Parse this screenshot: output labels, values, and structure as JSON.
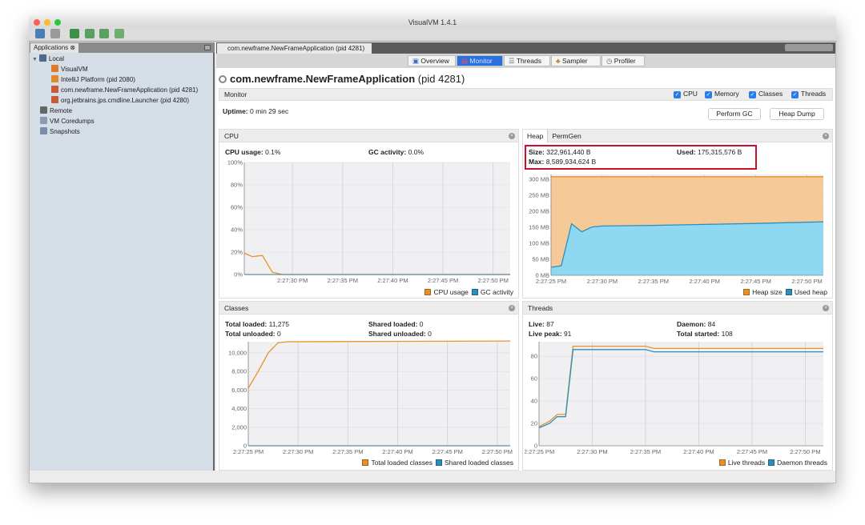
{
  "window": {
    "title": "VisualVM 1.4.1"
  },
  "toolbar": {
    "icons": [
      "open-icon",
      "save-icon",
      "add-jmx-icon",
      "add-coredump-icon",
      "add-remote-icon",
      "snapshot-icon"
    ]
  },
  "sidebar": {
    "tab": "Applications",
    "items": [
      {
        "label": "Local",
        "icon": "computer-icon"
      },
      {
        "label": "VisualVM",
        "icon": "visualvm-icon"
      },
      {
        "label": "IntelliJ Platform (pid 2080)",
        "icon": "intellij-icon"
      },
      {
        "label": "com.newframe.NewFrameApplication (pid 4281)",
        "icon": "java-icon"
      },
      {
        "label": "org.jetbrains.jps.cmdline.Launcher (pid 4280)",
        "icon": "java-icon"
      },
      {
        "label": "Remote",
        "icon": "remote-icon"
      },
      {
        "label": "VM Coredumps",
        "icon": "coredump-icon"
      },
      {
        "label": "Snapshots",
        "icon": "snapshot-icon"
      }
    ]
  },
  "doc_tab": "com.newframe.NewFrameApplication (pid 4281)",
  "view_tabs": [
    {
      "label": "Overview",
      "selected": false
    },
    {
      "label": "Monitor",
      "selected": true
    },
    {
      "label": "Threads",
      "selected": false
    },
    {
      "label": "Sampler",
      "selected": false
    },
    {
      "label": "Profiler",
      "selected": false
    }
  ],
  "app": {
    "name": "com.newframe.NewFrameApplication",
    "pid": "(pid 4281)"
  },
  "monitor": {
    "title": "Monitor",
    "checks": [
      "CPU",
      "Memory",
      "Classes",
      "Threads"
    ],
    "uptime_label": "Uptime:",
    "uptime": "0 min 29 sec",
    "perform_gc": "Perform GC",
    "heap_dump": "Heap Dump"
  },
  "colors": {
    "orange": "#e8912a",
    "blue": "#2a8fc0",
    "highlight": "#c8102e"
  },
  "cpu": {
    "title": "CPU",
    "usage_label": "CPU usage:",
    "usage": "0.1%",
    "gc_label": "GC activity:",
    "gc": "0.0%"
  },
  "heap": {
    "tabs": [
      "Heap",
      "PermGen"
    ],
    "size_label": "Size:",
    "size": "322,961,440 B",
    "used_label": "Used:",
    "used": "175,315,576 B",
    "max_label": "Max:",
    "max": "8,589,934,624 B"
  },
  "classes": {
    "title": "Classes",
    "total_loaded_label": "Total loaded:",
    "total_loaded": "11,275",
    "total_unloaded_label": "Total unloaded:",
    "total_unloaded": "0",
    "shared_loaded_label": "Shared loaded:",
    "shared_loaded": "0",
    "shared_unloaded_label": "Shared unloaded:",
    "shared_unloaded": "0"
  },
  "threads": {
    "title": "Threads",
    "live_label": "Live:",
    "live": "87",
    "daemon_label": "Daemon:",
    "daemon": "84",
    "peak_label": "Live peak:",
    "peak": "91",
    "started_label": "Total started:",
    "started": "108"
  },
  "chart_data": [
    {
      "id": "cpu",
      "type": "line",
      "xlim": [
        "2:27:25.2",
        "2:27:51.7"
      ],
      "ylim": [
        0,
        100
      ],
      "xticks": [
        "2:27:30 PM",
        "2:27:35 PM",
        "2:27:40 PM",
        "2:27:45 PM",
        "2:27:50 PM"
      ],
      "yticks": [
        0,
        20,
        40,
        60,
        80,
        100
      ],
      "ytick_labels": [
        "0%",
        "20%",
        "40%",
        "60%",
        "80%",
        "100%"
      ],
      "series": [
        {
          "name": "CPU usage",
          "color": "#e8912a",
          "fill": false,
          "points": [
            [
              "2:27:25.2",
              19
            ],
            [
              "2:27:26",
              16
            ],
            [
              "2:27:27",
              17
            ],
            [
              "2:27:28",
              2
            ],
            [
              "2:27:29",
              0
            ],
            [
              "2:27:51.7",
              0
            ]
          ]
        },
        {
          "name": "GC activity",
          "color": "#2a8fc0",
          "fill": false,
          "points": [
            [
              "2:27:25.2",
              0
            ],
            [
              "2:27:51.7",
              0
            ]
          ]
        }
      ]
    },
    {
      "id": "heap",
      "type": "area",
      "xlim": [
        "2:27:25",
        "2:27:51.6"
      ],
      "ylim": [
        0,
        315
      ],
      "xticks": [
        "2:27:25 PM",
        "2:27:30 PM",
        "2:27:35 PM",
        "2:27:40 PM",
        "2:27:45 PM",
        "2:27:50 PM"
      ],
      "yticks": [
        0,
        50,
        100,
        150,
        200,
        250,
        300
      ],
      "ytick_labels": [
        "0 MB",
        "50 MB",
        "100 MB",
        "150 MB",
        "200 MB",
        "250 MB",
        "300 MB"
      ],
      "series": [
        {
          "name": "Heap size",
          "color": "#e8912a",
          "fill": true,
          "points": [
            [
              "2:27:25",
              308
            ],
            [
              "2:27:51.6",
              308
            ]
          ]
        },
        {
          "name": "Used heap",
          "color": "#2a8fc0",
          "fill": true,
          "points": [
            [
              "2:27:25",
              25
            ],
            [
              "2:27:26",
              30
            ],
            [
              "2:27:27",
              161
            ],
            [
              "2:27:28",
              136
            ],
            [
              "2:27:29",
              151
            ],
            [
              "2:27:30",
              154
            ],
            [
              "2:27:35",
              156
            ],
            [
              "2:27:40",
              159
            ],
            [
              "2:27:45",
              162
            ],
            [
              "2:27:51.6",
              167
            ]
          ]
        }
      ]
    },
    {
      "id": "classes",
      "type": "line",
      "xlim": [
        "2:27:25",
        "2:27:51.3"
      ],
      "ylim": [
        0,
        11200
      ],
      "xticks": [
        "2:27:25 PM",
        "2:27:30 PM",
        "2:27:35 PM",
        "2:27:40 PM",
        "2:27:45 PM",
        "2:27:50 PM"
      ],
      "yticks": [
        0,
        2000,
        4000,
        6000,
        8000,
        10000
      ],
      "ytick_labels": [
        "0",
        "2,000",
        "4,000",
        "6,000",
        "8,000",
        "10,000"
      ],
      "series": [
        {
          "name": "Total loaded classes",
          "color": "#e8912a",
          "fill": false,
          "points": [
            [
              "2:27:25",
              6200
            ],
            [
              "2:27:26",
              8000
            ],
            [
              "2:27:27",
              10000
            ],
            [
              "2:27:28",
              11100
            ],
            [
              "2:27:29",
              11200
            ],
            [
              "2:27:51.3",
              11275
            ]
          ]
        },
        {
          "name": "Shared loaded classes",
          "color": "#2a8fc0",
          "fill": false,
          "points": [
            [
              "2:27:25",
              0
            ],
            [
              "2:27:51.3",
              0
            ]
          ]
        }
      ]
    },
    {
      "id": "threads",
      "type": "line",
      "xlim": [
        "2:27:25",
        "2:27:51.7"
      ],
      "ylim": [
        0,
        93
      ],
      "xticks": [
        "2:27:25 PM",
        "2:27:30 PM",
        "2:27:35 PM",
        "2:27:40 PM",
        "2:27:45 PM",
        "2:27:50 PM"
      ],
      "yticks": [
        0,
        20,
        40,
        60,
        80
      ],
      "ytick_labels": [
        "0",
        "20",
        "40",
        "60",
        "80"
      ],
      "series": [
        {
          "name": "Live threads",
          "color": "#e8912a",
          "fill": false,
          "points": [
            [
              "2:27:25",
              17
            ],
            [
              "2:27:26",
              22
            ],
            [
              "2:27:26.7",
              28
            ],
            [
              "2:27:27.5",
              28
            ],
            [
              "2:27:28.2",
              89
            ],
            [
              "2:27:35",
              89
            ],
            [
              "2:27:35.8",
              87
            ],
            [
              "2:27:51.7",
              87
            ]
          ]
        },
        {
          "name": "Daemon threads",
          "color": "#2a8fc0",
          "fill": false,
          "points": [
            [
              "2:27:25",
              16
            ],
            [
              "2:27:26",
              20
            ],
            [
              "2:27:26.7",
              26
            ],
            [
              "2:27:27.5",
              26
            ],
            [
              "2:27:28.2",
              86
            ],
            [
              "2:27:35",
              86
            ],
            [
              "2:27:35.8",
              84
            ],
            [
              "2:27:51.7",
              84
            ]
          ]
        }
      ]
    }
  ]
}
